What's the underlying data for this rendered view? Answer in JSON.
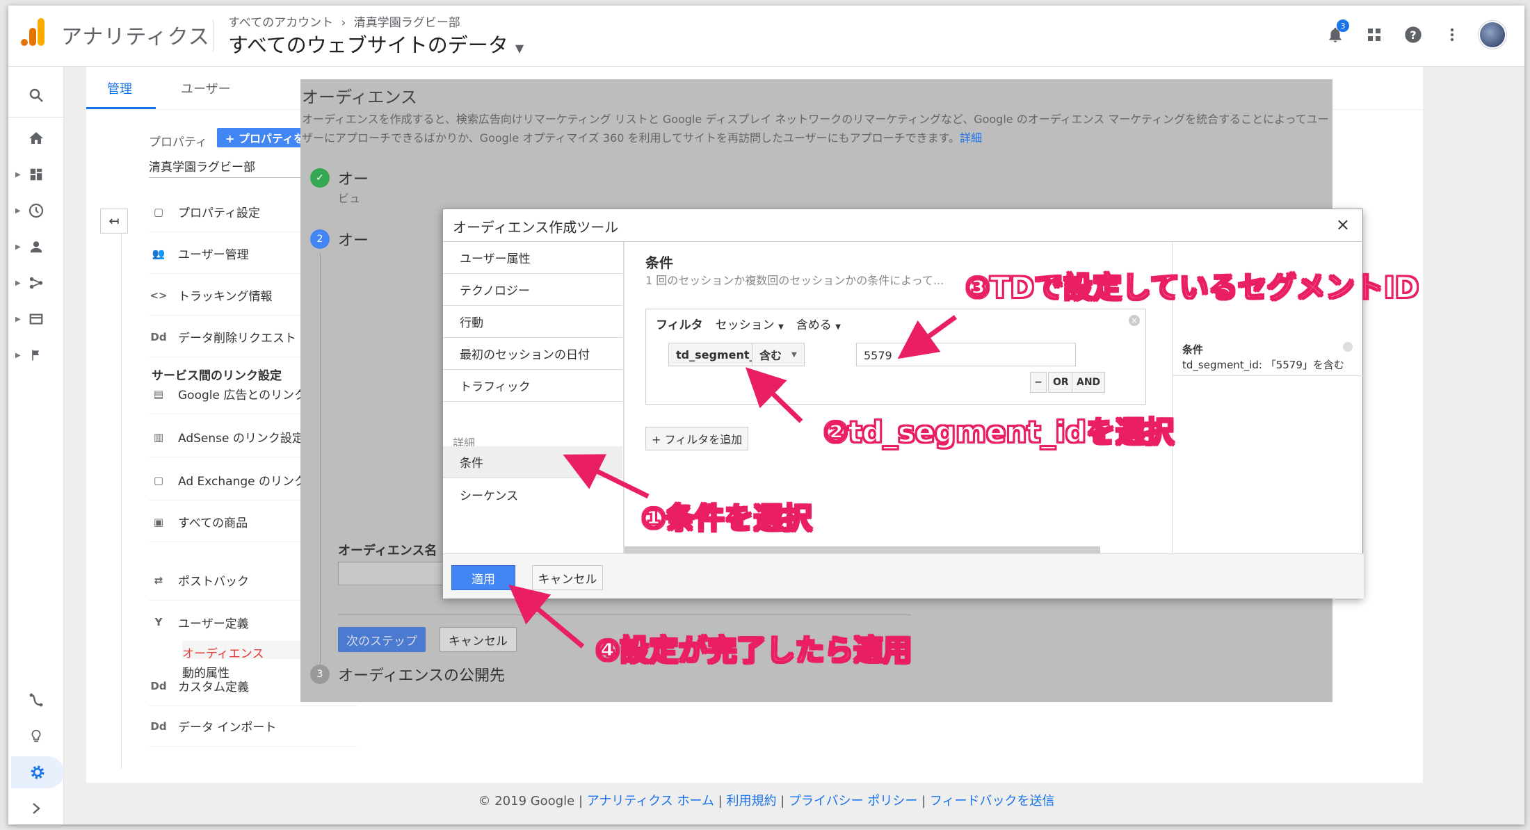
{
  "header": {
    "app_name": "アナリティクス",
    "breadcrumb": [
      "すべてのアカウント",
      "›",
      "清真学園ラグビー部"
    ],
    "view_name": "すべてのウェブサイトのデータ",
    "notification_count": "3"
  },
  "tabs": [
    "管理",
    "ユーザー"
  ],
  "property": {
    "label": "プロパティ",
    "create_label": "+ プロパティを作成",
    "selected": "清真学園ラグビー部",
    "menu": [
      "プロパティ設定",
      "ユーザー管理",
      "トラッキング情報",
      "データ削除リクエスト"
    ],
    "link_section": "サービス間のリンク設定",
    "link_items": [
      "Google 広告とのリンク",
      "AdSense のリンク設定",
      "Ad Exchange のリンク設定",
      "すべての商品"
    ],
    "postback": "ポストバック",
    "user_def": "ユーザー定義",
    "user_def_sub": [
      "オーディエンス",
      "動的属性"
    ],
    "custom_def": "カスタム定義",
    "data_import": "データ インポート"
  },
  "audience_page": {
    "title": "オーディエンス",
    "description": "オーディエンスを作成すると、検索広告向けリマーケティング リストと Google ディスプレイ ネットワークのリマーケティングなど、Google のオーディエンス マーケティングを統合することによってユーザーにアプローチできるばかりか、Google オプティマイズ 360 を利用してサイトを再訪問したユーザーにもアプローチできます。",
    "detail_link": "詳細",
    "step1_fragment": "オー",
    "step1_sub": "ビュ",
    "step2_fragment": "オー",
    "audience_name_label": "オーディエンス名",
    "next_step": "次のステップ",
    "cancel": "キャンセル",
    "step3": "オーディエンスの公開先",
    "step_numbers": [
      "2",
      "3"
    ]
  },
  "dialog": {
    "title": "オーディエンス作成ツール",
    "side_items": [
      "ユーザー属性",
      "テクノロジー",
      "行動",
      "最初のセッションの日付",
      "トラフィック"
    ],
    "side_head": "詳細",
    "side_adv": [
      "条件",
      "シーケンス"
    ],
    "cond_count": "1",
    "cond_title": "条件",
    "cond_desc": "1 回のセッションか複数回のセッションかの条件によって...",
    "filter_label": "フィルタ",
    "scope": "セッション",
    "include": "含める",
    "dimension": "td_segment_id",
    "operator": "含む",
    "value": "5579",
    "minus": "−",
    "or": "OR",
    "and": "AND",
    "add_filter": "+ フィルタを追加",
    "summary_title": "条件",
    "summary_text": "td_segment_id: 「5579」を含む",
    "apply": "適用",
    "cancel": "キャンセル"
  },
  "annotations": {
    "a1": "①条件を選択",
    "a2": "②td_segment_idを選択",
    "a3": "③TDで設定しているセグメントID",
    "a4": "④設定が完了したら適用"
  },
  "footer": {
    "copyright": "© 2019 Google",
    "links": [
      "アナリティクス ホーム",
      "利用規約",
      "プライバシー ポリシー",
      "フィードバックを送信"
    ]
  },
  "colors": {
    "accent": "#1a73e8",
    "annotation": "#e91e63",
    "apply": "#4285f4"
  }
}
